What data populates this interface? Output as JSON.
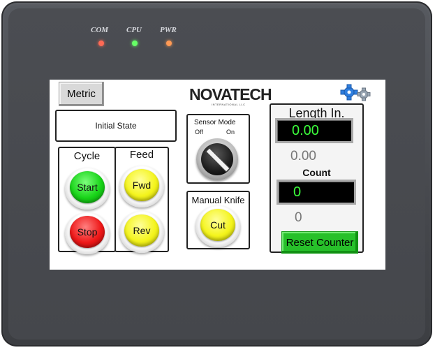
{
  "device": {
    "indicators": [
      {
        "label": "COM",
        "color": "#ff6a55"
      },
      {
        "label": "CPU",
        "color": "#66ff66"
      },
      {
        "label": "PWR",
        "color": "#ff9a55"
      }
    ]
  },
  "toolbar": {
    "metric_label": "Metric"
  },
  "status": {
    "state_text": "Initial State"
  },
  "cycle": {
    "title": "Cycle",
    "start_label": "Start",
    "stop_label": "Stop"
  },
  "feed": {
    "title": "Feed",
    "fwd_label": "Fwd",
    "rev_label": "Rev"
  },
  "logo": {
    "text": "NOVATECH",
    "subtext": "INTERNATIONAL LLC"
  },
  "sensor": {
    "title": "Sensor Mode",
    "off_label": "Off",
    "on_label": "On"
  },
  "knife": {
    "title": "Manual Knife",
    "cut_label": "Cut"
  },
  "length": {
    "title": "Length In.",
    "display_value": "0.00",
    "plain_value": "0.00"
  },
  "count": {
    "title": "Count",
    "display_value": "0",
    "plain_value": "0"
  },
  "reset": {
    "label": "Reset Counter"
  },
  "icons": {
    "settings": "gears-icon"
  },
  "colors": {
    "start": "#18d418",
    "stop": "#ee1818",
    "feed": "#f4f41c",
    "display_text": "#3cff3c",
    "reset": "#27c02a"
  }
}
